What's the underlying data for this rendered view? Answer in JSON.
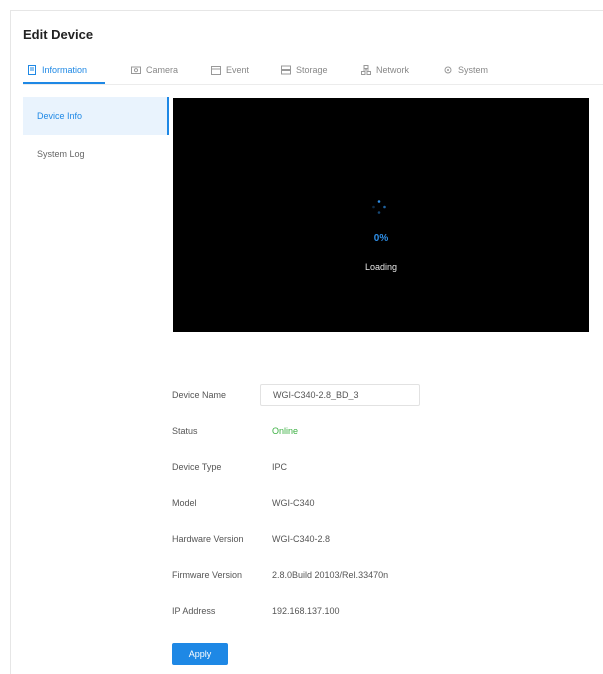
{
  "header": {
    "title": "Edit Device"
  },
  "tabs": [
    {
      "label": "Information",
      "icon": "info-icon",
      "active": true
    },
    {
      "label": "Camera",
      "icon": "camera-icon",
      "active": false
    },
    {
      "label": "Event",
      "icon": "event-icon",
      "active": false
    },
    {
      "label": "Storage",
      "icon": "storage-icon",
      "active": false
    },
    {
      "label": "Network",
      "icon": "network-icon",
      "active": false
    },
    {
      "label": "System",
      "icon": "system-icon",
      "active": false
    }
  ],
  "sidebar": {
    "items": [
      {
        "label": "Device Info",
        "active": true
      },
      {
        "label": "System Log",
        "active": false
      }
    ]
  },
  "video": {
    "progress_text": "0%",
    "status_text": "Loading"
  },
  "device_info": {
    "name": {
      "label": "Device Name",
      "value": "WGI-C340-2.8_BD_3"
    },
    "status": {
      "label": "Status",
      "value": "Online"
    },
    "type": {
      "label": "Device Type",
      "value": "IPC"
    },
    "model": {
      "label": "Model",
      "value": "WGI-C340"
    },
    "hardware": {
      "label": "Hardware Version",
      "value": "WGI-C340-2.8"
    },
    "firmware": {
      "label": "Firmware Version",
      "value": "2.8.0Build 20103/Rel.33470n"
    },
    "ip": {
      "label": "IP Address",
      "value": "192.168.137.100"
    }
  },
  "actions": {
    "apply_label": "Apply"
  },
  "colors": {
    "accent": "#1e88e5",
    "online": "#3cb043",
    "video_bg": "#000000"
  }
}
